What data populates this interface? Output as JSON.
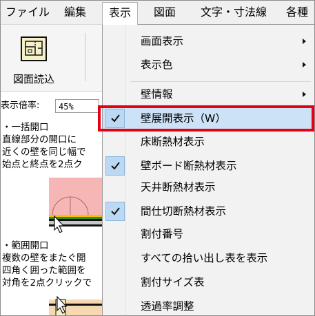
{
  "menubar": {
    "items": [
      "ファイル",
      "編集",
      "表示",
      "図面",
      "文字・寸法線",
      "各種"
    ],
    "active_index": 2
  },
  "toolbar": {
    "button_label": "図面読込",
    "icon": "drawing-import-icon"
  },
  "left_panel": {
    "scale_label": "表示倍率:",
    "scale_value": "45%",
    "help_lines_1": [
      "・一括開口",
      "直線部分の開口に",
      "近くの壁を同じ幅で",
      "始点と終点を2点ク"
    ],
    "help_lines_2": [
      "・範囲開口",
      "複数の壁をまたぐ開",
      "四角く囲った範囲を",
      "対角を2点クリックで"
    ]
  },
  "dropdown": {
    "items": [
      {
        "label": "画面表示",
        "submenu": true,
        "checked": false
      },
      {
        "label": "表示色",
        "submenu": true,
        "checked": false
      },
      {
        "label": "壁情報",
        "submenu": true,
        "checked": false
      },
      {
        "label": "壁展開表示（W）",
        "submenu": false,
        "checked": true,
        "highlighted": true
      },
      {
        "label": "床断熱材表示",
        "submenu": false,
        "checked": false
      },
      {
        "label": "壁ボード断熱材表示",
        "submenu": false,
        "checked": true
      },
      {
        "label": "天井断熱材表示",
        "submenu": false,
        "checked": false
      },
      {
        "label": "間仕切断熱材表示",
        "submenu": false,
        "checked": true
      },
      {
        "label": "割付番号",
        "submenu": false,
        "checked": false
      },
      {
        "label": "すべての拾い出し表を表示",
        "submenu": false,
        "checked": false
      },
      {
        "label": "割付サイズ表",
        "submenu": false,
        "checked": false
      },
      {
        "label": "透過率調整",
        "submenu": false,
        "checked": false
      }
    ]
  },
  "colors": {
    "highlight": "#cce2f6",
    "check_box": "#bcd9f3",
    "annotation_box": "#e60012",
    "diagram_pink": "#f6b6b6"
  }
}
